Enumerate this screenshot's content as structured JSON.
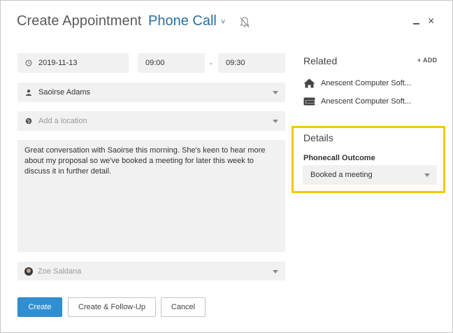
{
  "header": {
    "title": "Create Appointment",
    "type_label": "Phone Call",
    "type_chevron": "˅",
    "bell_icon": "bell-off-icon",
    "close_glyph": "×"
  },
  "form": {
    "date": "2019-11-13",
    "start_time": "09:00",
    "time_separator": "-",
    "end_time": "09:30",
    "contact": "Saoirse Adams",
    "location_placeholder": "Add a location",
    "notes": "Great conversation with Saoirse this morning. She's keen to hear more about my proposal so we've booked a meeting for later this week to discuss it in further detail.",
    "owner": "Zoe Saldana"
  },
  "buttons": {
    "create": "Create",
    "create_follow_up": "Create & Follow-Up",
    "cancel": "Cancel"
  },
  "related": {
    "title": "Related",
    "add_label": "+ ADD",
    "items": [
      {
        "label": "Anescent Computer Soft...",
        "icon": "home-icon"
      },
      {
        "label": "Anescent Computer Soft...",
        "icon": "wallet-icon"
      }
    ]
  },
  "details": {
    "title": "Details",
    "outcome_label": "Phonecall Outcome",
    "outcome_value": "Booked a meeting",
    "highlight_color": "#f5c800"
  },
  "colors": {
    "accent": "#2f8fd1",
    "type_text": "#2b6f9e"
  }
}
